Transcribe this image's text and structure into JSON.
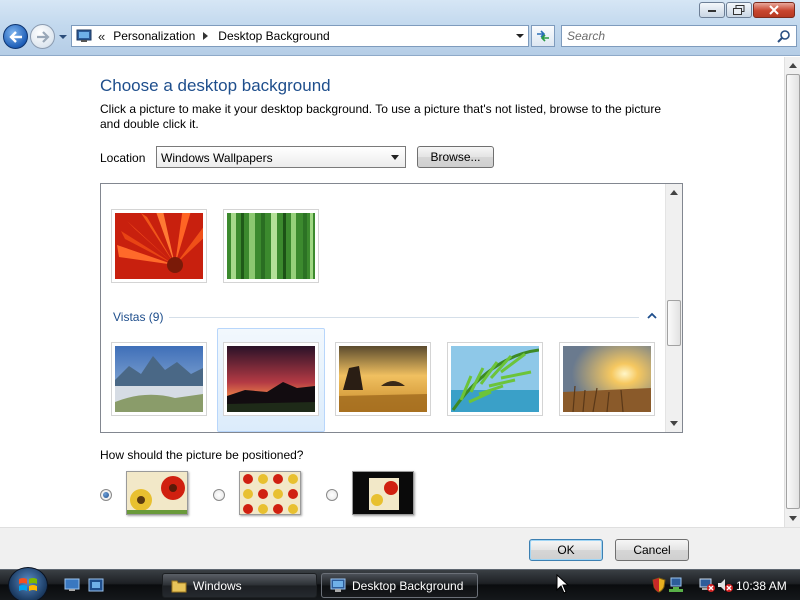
{
  "window": {
    "minimize": "minimize",
    "maximize": "maximize",
    "close": "close"
  },
  "address": {
    "chevron": "«",
    "breadcrumb": [
      "Personalization",
      "Desktop Background"
    ]
  },
  "search": {
    "placeholder": "Search"
  },
  "page": {
    "title": "Choose a desktop background",
    "description": "Click a picture to make it your desktop background. To use a picture that's not listed, browse to the picture and double click it.",
    "location_label": "Location",
    "location_value": "Windows Wallpapers",
    "browse_label": "Browse...",
    "group_title": "Vistas (9)",
    "position_question": "How should the picture be positioned?",
    "position_options": [
      "fit-to-screen",
      "tile",
      "center"
    ],
    "position_selected": 0,
    "wallpapers_top": [
      "red flower",
      "green bamboo"
    ],
    "wallpapers_vistas": [
      "mountain river",
      "dusk silhouette",
      "golden rocks",
      "palm leaf",
      "sunset field"
    ],
    "selected_wallpaper": "dusk silhouette"
  },
  "buttons": {
    "ok": "OK",
    "cancel": "Cancel"
  },
  "taskbar": {
    "tasks": [
      {
        "label": "Windows",
        "icon": "folder-icon",
        "active": false
      },
      {
        "label": "Desktop Background",
        "icon": "monitor-icon",
        "active": true
      }
    ],
    "clock": "10:38 AM"
  },
  "colors": {
    "title_blue": "#1e4e8c",
    "selection": "#dcecfb",
    "taskbar": "#1d2024"
  }
}
